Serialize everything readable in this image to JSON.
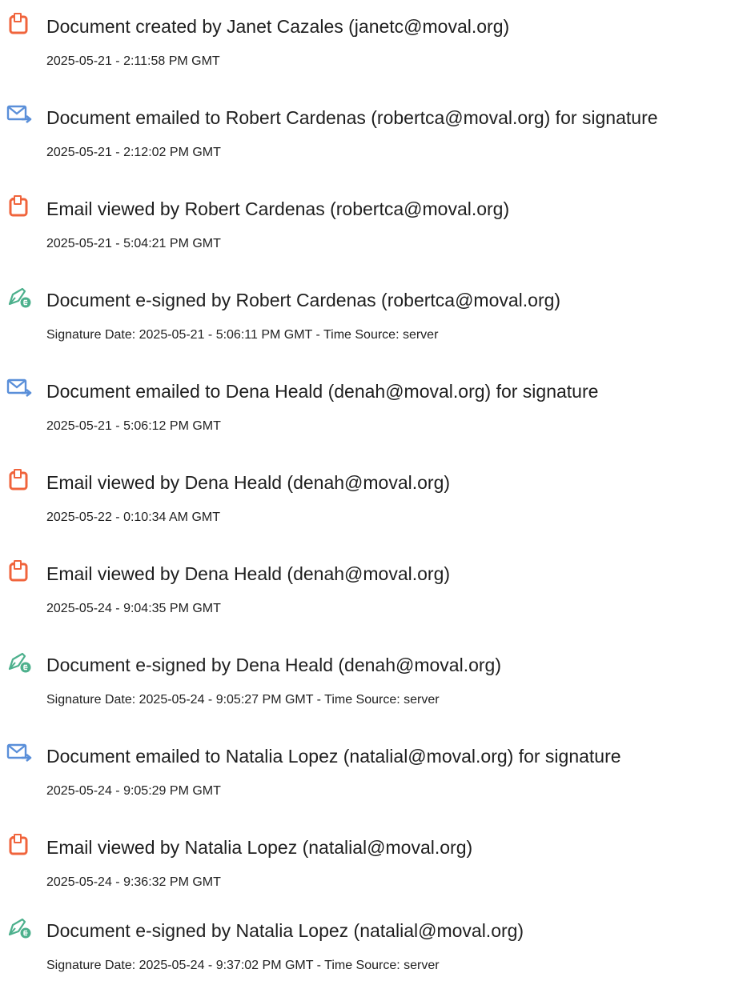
{
  "colors": {
    "doc_icon": "#F0643C",
    "mail_icon": "#5A8FD9",
    "sign_icon": "#4CB08C",
    "text": "#1f1f1f"
  },
  "events": [
    {
      "icon": "document-icon",
      "title": "Document created by Janet Cazales (janetc@moval.org)",
      "time": "2025-05-21 - 2:11:58 PM GMT"
    },
    {
      "icon": "email-sent-icon",
      "title": "Document emailed to Robert Cardenas (robertca@moval.org) for signature",
      "time": "2025-05-21 - 2:12:02 PM GMT"
    },
    {
      "icon": "document-icon",
      "title": "Email viewed by Robert Cardenas (robertca@moval.org)",
      "time": "2025-05-21 - 5:04:21 PM GMT"
    },
    {
      "icon": "e-sign-icon",
      "title": "Document e-signed by Robert Cardenas (robertca@moval.org)",
      "time": "Signature Date: 2025-05-21 - 5:06:11 PM GMT - Time Source: server"
    },
    {
      "icon": "email-sent-icon",
      "title": "Document emailed to Dena Heald (denah@moval.org) for signature",
      "time": "2025-05-21 - 5:06:12 PM GMT"
    },
    {
      "icon": "document-icon",
      "title": "Email viewed by Dena Heald (denah@moval.org)",
      "time": "2025-05-22 - 0:10:34 AM GMT"
    },
    {
      "icon": "document-icon",
      "title": "Email viewed by Dena Heald (denah@moval.org)",
      "time": "2025-05-24 - 9:04:35 PM GMT"
    },
    {
      "icon": "e-sign-icon",
      "title": "Document e-signed by Dena Heald (denah@moval.org)",
      "time": "Signature Date: 2025-05-24 - 9:05:27 PM GMT - Time Source: server"
    },
    {
      "icon": "email-sent-icon",
      "title": "Document emailed to Natalia Lopez (natalial@moval.org) for signature",
      "time": "2025-05-24 - 9:05:29 PM GMT"
    },
    {
      "icon": "document-icon",
      "title": "Email viewed by Natalia Lopez (natalial@moval.org)",
      "time": "2025-05-24 - 9:36:32 PM GMT"
    },
    {
      "icon": "e-sign-icon",
      "title": "Document e-signed by Natalia Lopez (natalial@moval.org)",
      "time": "Signature Date: 2025-05-24 - 9:37:02 PM GMT - Time Source: server"
    }
  ]
}
